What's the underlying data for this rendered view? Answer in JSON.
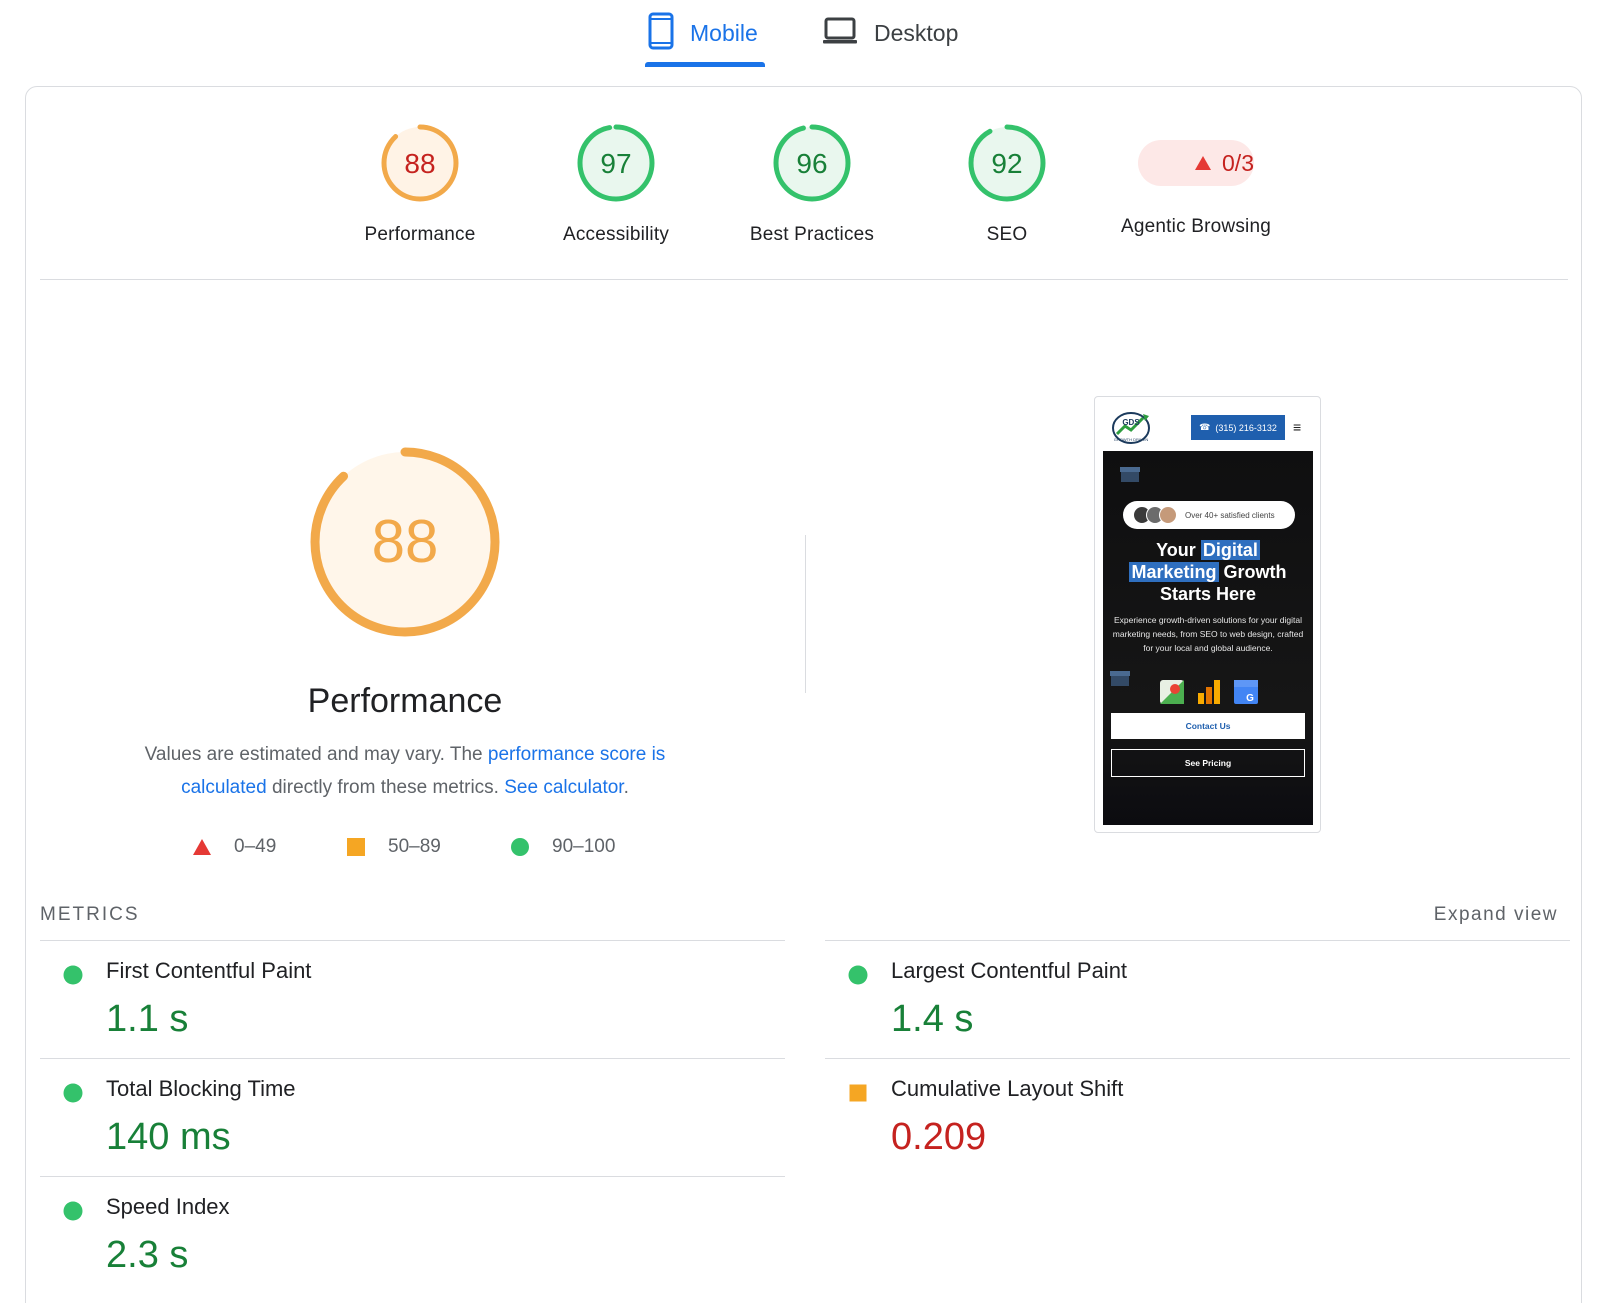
{
  "tabs": {
    "mobile": {
      "label": "Mobile"
    },
    "desktop": {
      "label": "Desktop"
    },
    "active": "mobile"
  },
  "colors": {
    "accent": "#1a73e8",
    "pass": "#0cce6b",
    "average": "#ffa400",
    "fail": "#ff4e42",
    "pass_text": "#188038",
    "average_text": "#c5221f"
  },
  "categories": [
    {
      "label": "Performance",
      "score": 88,
      "rating": "average"
    },
    {
      "label": "Accessibility",
      "score": 97,
      "rating": "pass"
    },
    {
      "label": "Best Practices",
      "score": 96,
      "rating": "pass"
    },
    {
      "label": "SEO",
      "score": 92,
      "rating": "pass"
    }
  ],
  "agentic": {
    "label": "Agentic Browsing",
    "value": "0/3",
    "icon": "warning-triangle-icon"
  },
  "performance": {
    "title": "Performance",
    "score": 88,
    "desc_prefix": "Values are estimated and may vary. The ",
    "link_score": "performance score is calculated",
    "desc_middle": " directly from these metrics. ",
    "link_calc": "See calculator",
    "desc_suffix": "."
  },
  "legend": [
    {
      "range": "0–49",
      "shape": "triangle-icon"
    },
    {
      "range": "50–89",
      "shape": "square-icon"
    },
    {
      "range": "90–100",
      "shape": "circle-icon"
    }
  ],
  "screenshot": {
    "logo_text": "GDS",
    "logo_sub": "GROWTH DRIVEN",
    "phone": "(315) 216-3132",
    "pill_text": "Over 40+ satisfied clients",
    "headline": {
      "word1": "Your",
      "word2": "Digital",
      "word3": "Marketing",
      "word4": "Growth",
      "line3": "Starts Here"
    },
    "body": "Experience growth-driven solutions for your digital marketing needs, from SEO to web design, crafted for your local and global audience.",
    "btn_primary": "Contact Us",
    "btn_secondary": "See Pricing"
  },
  "metrics": {
    "heading": "METRICS",
    "expand": "Expand view",
    "items": [
      {
        "name": "First Contentful Paint",
        "value": "1.1 s",
        "rating": "pass"
      },
      {
        "name": "Largest Contentful Paint",
        "value": "1.4 s",
        "rating": "pass"
      },
      {
        "name": "Total Blocking Time",
        "value": "140 ms",
        "rating": "pass"
      },
      {
        "name": "Cumulative Layout Shift",
        "value": "0.209",
        "rating": "average"
      },
      {
        "name": "Speed Index",
        "value": "2.3 s",
        "rating": "pass"
      }
    ]
  }
}
